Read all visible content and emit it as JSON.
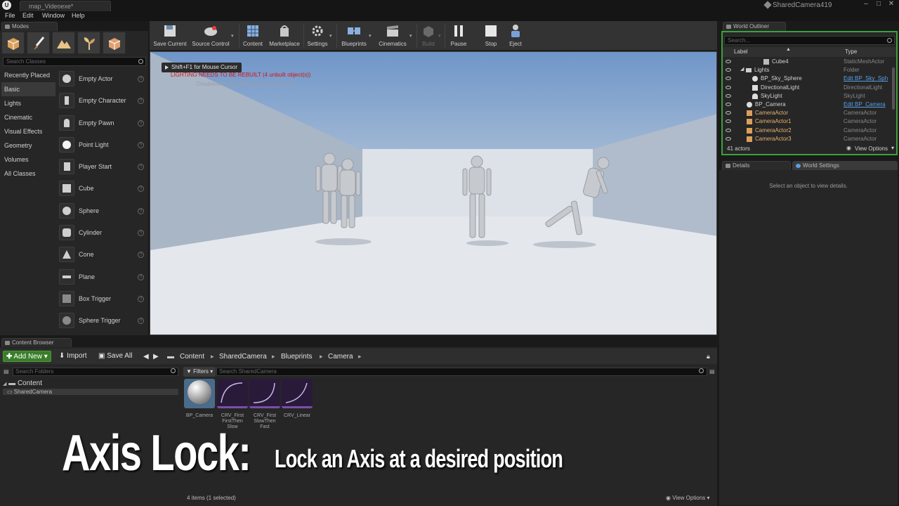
{
  "titlebar": {
    "map_tab": "map_Videoexe*",
    "project": "SharedCamera419"
  },
  "menu": [
    "File",
    "Edit",
    "Window",
    "Help"
  ],
  "modes": {
    "tab_label": "Modes",
    "search_placeholder": "Search Classes",
    "categories": [
      "Recently Placed",
      "Basic",
      "Lights",
      "Cinematic",
      "Visual Effects",
      "Geometry",
      "Volumes",
      "All Classes"
    ],
    "active_category": "Basic",
    "classes": [
      "Empty Actor",
      "Empty Character",
      "Empty Pawn",
      "Point Light",
      "Player Start",
      "Cube",
      "Sphere",
      "Cylinder",
      "Cone",
      "Plane",
      "Box Trigger",
      "Sphere Trigger"
    ]
  },
  "toolbar": {
    "save": "Save Current",
    "source_control": "Source Control",
    "content": "Content",
    "marketplace": "Marketplace",
    "settings": "Settings",
    "blueprints": "Blueprints",
    "cinematics": "Cinematics",
    "build": "Build",
    "pause": "Pause",
    "stop": "Stop",
    "eject": "Eject"
  },
  "viewport": {
    "hint": "Shift+F1 for Mouse Cursor",
    "warning": "LIGHTING NEEDS TO BE REBUILT (4 unbuilt object(s))",
    "suppress": "'DisableAllScreenMessages' to suppress"
  },
  "outliner": {
    "tab_label": "World Outliner",
    "search_placeholder": "Search...",
    "col_label": "Label",
    "col_type": "Type",
    "rows": [
      {
        "name": "Cube4",
        "type": "StaticMeshActor",
        "link": false
      },
      {
        "name": "Lights",
        "type": "Folder",
        "link": false
      },
      {
        "name": "BP_Sky_Sphere",
        "type": "Edit BP_Sky_Sph",
        "link": true
      },
      {
        "name": "DirectionalLight",
        "type": "DirectionalLight",
        "link": false
      },
      {
        "name": "SkyLight",
        "type": "SkyLight",
        "link": false
      },
      {
        "name": "BP_Camera",
        "type": "Edit BP_Camera",
        "link": true
      },
      {
        "name": "CameraActor",
        "type": "CameraActor",
        "link": false
      },
      {
        "name": "CameraActor1",
        "type": "CameraActor",
        "link": false
      },
      {
        "name": "CameraActor2",
        "type": "CameraActor",
        "link": false
      },
      {
        "name": "CameraActor3",
        "type": "CameraActor",
        "link": false
      }
    ],
    "count": "41 actors",
    "view_options": "View Options"
  },
  "details": {
    "tab_details": "Details",
    "tab_world": "World Settings",
    "empty": "Select an object to view details."
  },
  "content_browser": {
    "tab_label": "Content Browser",
    "add_new": "Add New",
    "import": "Import",
    "save_all": "Save All",
    "path": [
      "Content",
      "SharedCamera",
      "Blueprints",
      "Camera"
    ],
    "folder_search": "Search Folders",
    "filters": "Filters",
    "asset_search": "Search SharedCamera",
    "tree_root": "Content",
    "tree_child": "SharedCamera",
    "assets": [
      {
        "name": "BP_Camera",
        "kind": "sphere"
      },
      {
        "name": "CRV_First FirstThen Slow",
        "kind": "curve"
      },
      {
        "name": "CRV_First SlowThen Fast",
        "kind": "curve"
      },
      {
        "name": "CRV_Linear",
        "kind": "curve"
      }
    ],
    "item_count": "4 items (1 selected)",
    "view_options": "View Options"
  },
  "caption": {
    "main": "Axis Lock:",
    "sub": "Lock an Axis at a desired position"
  }
}
